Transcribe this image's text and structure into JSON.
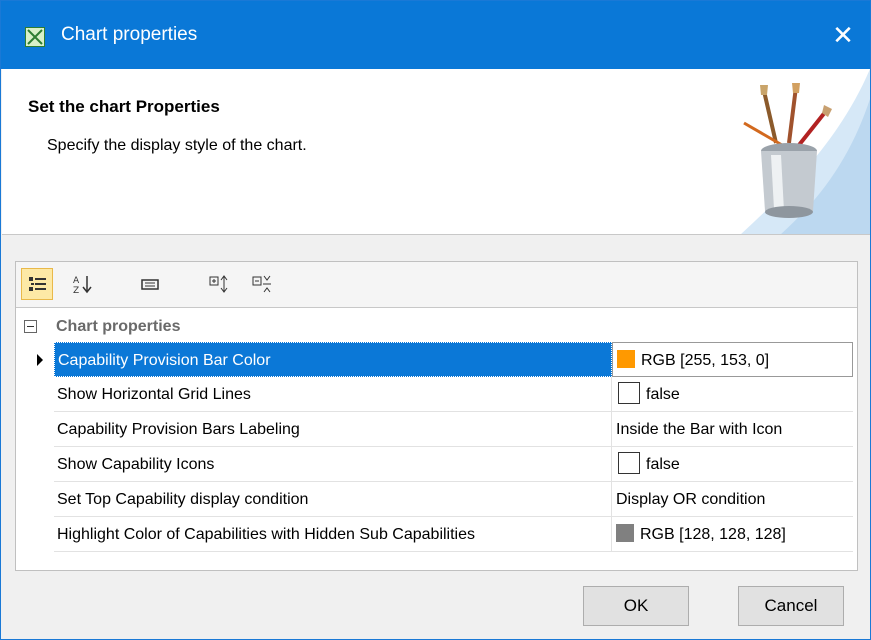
{
  "window": {
    "title": "Chart properties",
    "close_glyph": "✕"
  },
  "header": {
    "title": "Set the chart Properties",
    "description": "Specify the display style of the chart."
  },
  "toolbar": {
    "buttons": [
      {
        "icon": "categorized-view-icon",
        "active": true
      },
      {
        "icon": "sort-alphabetical-icon",
        "active": false
      },
      {
        "icon": "description-icon",
        "active": false
      },
      {
        "icon": "expand-all-icon",
        "active": false
      },
      {
        "icon": "collapse-all-icon",
        "active": false
      }
    ]
  },
  "properties": {
    "group_label": "Chart properties",
    "rows": [
      {
        "name": "Capability Provision Bar Color",
        "value": "RGB [255, 153, 0]",
        "swatch": "#ff9900"
      },
      {
        "name": "Show Horizontal Grid Lines",
        "value": "false"
      },
      {
        "name": "Capability Provision Bars Labeling",
        "value": "Inside the Bar with Icon"
      },
      {
        "name": "Show Capability Icons",
        "value": "false"
      },
      {
        "name": "Set Top Capability display condition",
        "value": "Display OR condition"
      },
      {
        "name": "Highlight Color of Capabilities with Hidden Sub Capabilities",
        "value": "RGB [128, 128, 128]",
        "swatch": "#808080"
      }
    ]
  },
  "buttons": {
    "ok": "OK",
    "cancel": "Cancel"
  },
  "colors": {
    "title_bar": "#0a78d7",
    "selection": "#0b78d7"
  }
}
